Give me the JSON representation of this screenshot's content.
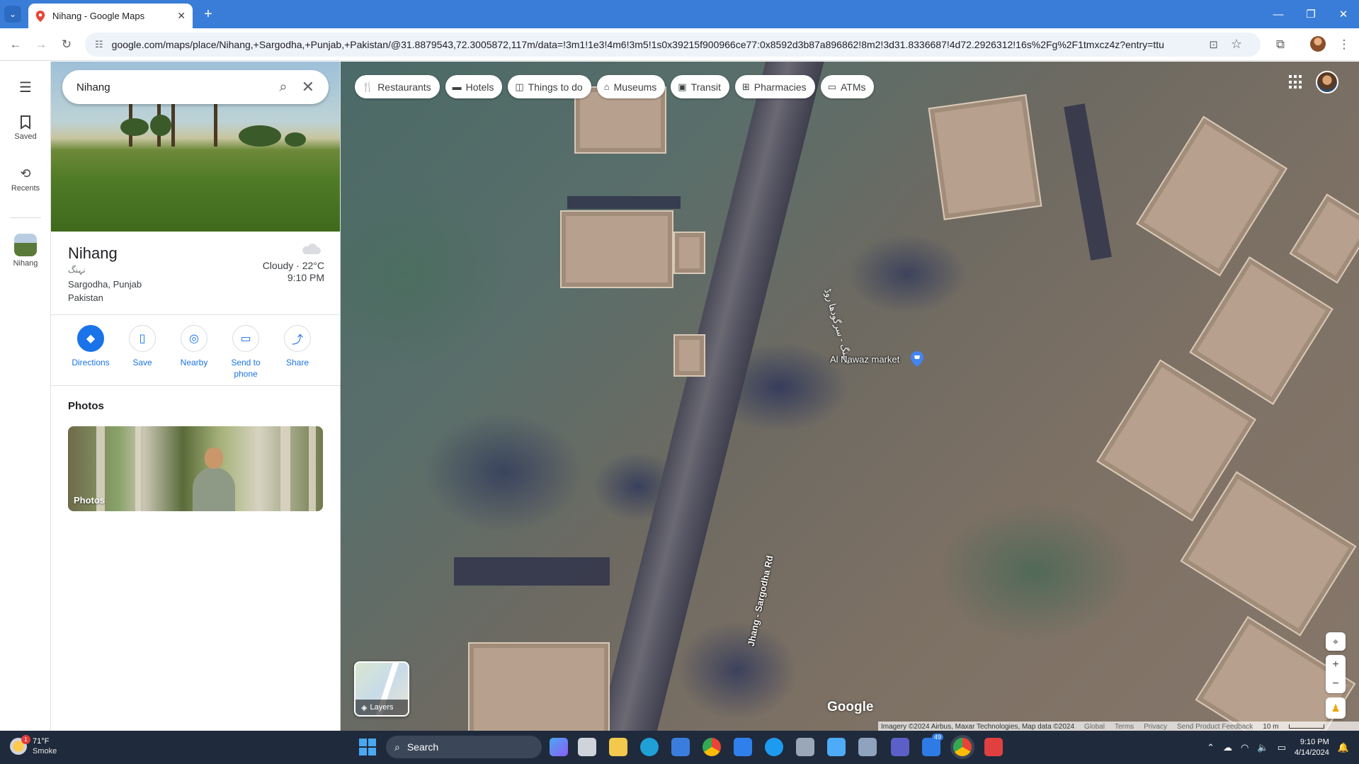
{
  "browser": {
    "tab_title": "Nihang - Google Maps",
    "url": "google.com/maps/place/Nihang,+Sargodha,+Punjab,+Pakistan/@31.8879543,72.3005872,117m/data=!3m1!1e3!4m6!3m5!1s0x39215f900966ce77:0x8592d3b87a896862!8m2!3d31.8336687!4d72.2926312!16s%2Fg%2F1tmxcz4z?entry=ttu"
  },
  "rail": {
    "menu_icon": "hamburger-menu-icon",
    "items": [
      {
        "label": "Saved",
        "icon": "bookmark-icon"
      },
      {
        "label": "Recents",
        "icon": "history-icon"
      },
      {
        "label": "Nihang",
        "icon": "place-thumbnail"
      }
    ]
  },
  "search": {
    "value": "Nihang",
    "search_icon": "search-icon",
    "clear_icon": "close-icon"
  },
  "place": {
    "name": "Nihang",
    "native_name": "نہنگ",
    "address_line1": "Sargodha, Punjab",
    "address_line2": "Pakistan",
    "weather": "Cloudy · 22°C",
    "weather_time": "9:10 PM",
    "weather_icon": "cloud-icon"
  },
  "actions": [
    {
      "label": "Directions",
      "icon": "directions-icon"
    },
    {
      "label": "Save",
      "icon": "bookmark-icon"
    },
    {
      "label": "Nearby",
      "icon": "nearby-icon"
    },
    {
      "label": "Send to\nphone",
      "icon": "send-to-phone-icon"
    },
    {
      "label": "Share",
      "icon": "share-icon"
    }
  ],
  "photos": {
    "title": "Photos",
    "card_label": "Photos"
  },
  "map": {
    "chips": [
      {
        "label": "Restaurants",
        "icon": "restaurant-icon"
      },
      {
        "label": "Hotels",
        "icon": "hotel-icon"
      },
      {
        "label": "Things to do",
        "icon": "camera-icon"
      },
      {
        "label": "Museums",
        "icon": "museum-icon"
      },
      {
        "label": "Transit",
        "icon": "transit-icon"
      },
      {
        "label": "Pharmacies",
        "icon": "pharmacy-icon"
      },
      {
        "label": "ATMs",
        "icon": "atm-icon"
      }
    ],
    "poi_label": "Al Nawaz market",
    "road_label": "Jhang - Sargodha Rd",
    "road_label_urdu": "جھنگ - سرگودھا روڈ",
    "layers_label": "Layers",
    "logo": "Google",
    "attribution": "Imagery ©2024 Airbus, Maxar Technologies, Map data ©2024",
    "footer_links": [
      "Global",
      "Terms",
      "Privacy",
      "Send Product Feedback"
    ],
    "scale": "10 m"
  },
  "taskbar": {
    "temp": "71°F",
    "condition": "Smoke",
    "weather_badge": "1",
    "search_label": "Search",
    "teams_badge": "49",
    "time": "9:10 PM",
    "date": "4/14/2024"
  },
  "colors": {
    "accent": "#1a73e8",
    "chrome_tabbar": "#3a7dd8",
    "taskbar": "#1f2a3c"
  }
}
